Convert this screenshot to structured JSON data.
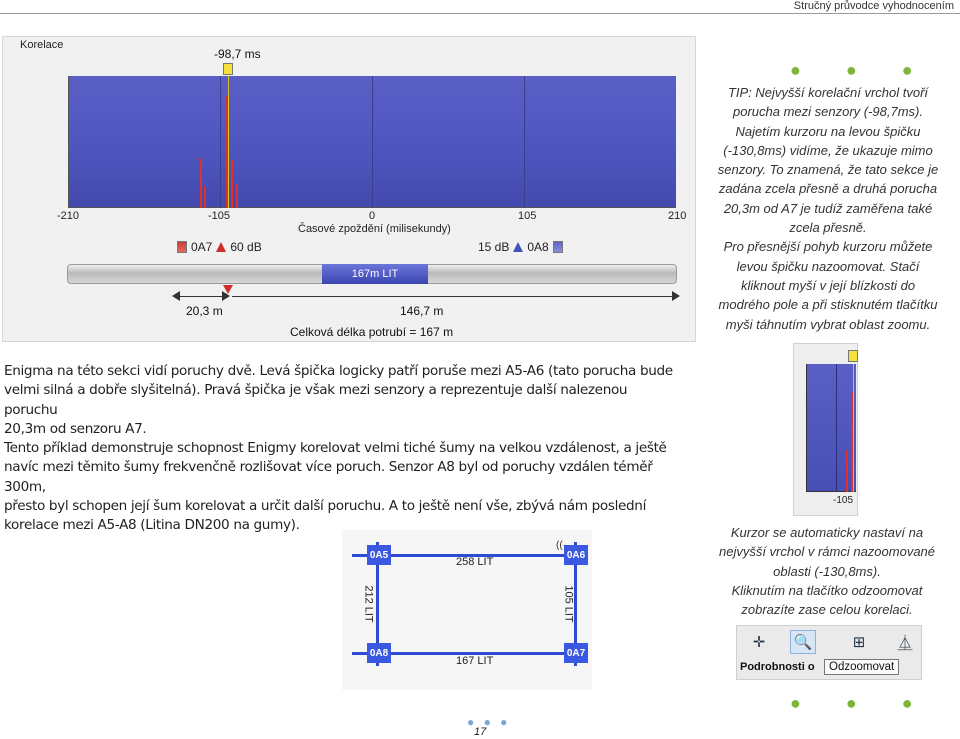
{
  "header": {
    "title": "Stručný průvodce vyhodnocením"
  },
  "correlation": {
    "panel_title": "Korelace",
    "cursor_label": "-98,7 ms",
    "ticks": [
      "-210",
      "-105",
      "0",
      "105",
      "210"
    ],
    "axis_label": "Časové zpoždění (milisekundy)",
    "left_sensor": {
      "name": "0A7",
      "level": "60 dB"
    },
    "right_sensor": {
      "name": "0A8",
      "level": "15 dB"
    },
    "pipe_label": "167m LIT",
    "dist_left": "20,3 m",
    "dist_right": "146,7 m",
    "total_length": "Celková délka potrubí = 167 m",
    "colors": {
      "plot": "#5057c0",
      "spike": "#e0302a",
      "cursor": "#f4e23c"
    }
  },
  "tip": {
    "lines": [
      "TIP: Nejvyšší korelační vrchol tvoří",
      "porucha mezi senzory (-98,7ms).",
      "Najetím kurzoru na levou špičku",
      "(-130,8ms) vidíme, že ukazuje mimo",
      "senzory. To znamená, že tato sekce je",
      "zadána zcela přesně a druhá porucha",
      "20,3m od A7 je tudíž zaměřena také",
      "zcela přesně.",
      "Pro přesnější pohyb kurzoru můžete",
      "levou špičku nazoomovat. Stačí",
      "kliknout myší v její blízkosti do",
      "modrého pole a při stisknutém tlačítku",
      "myši táhnutím vybrat oblast zoomu."
    ]
  },
  "body": {
    "para1": [
      "Enigma na této sekci vidí poruchy dvě. Levá špička logicky patří poruše mezi A5-A6 (tato porucha bude",
      "velmi silná a dobře slyšitelná). Pravá špička je však mezi senzory a reprezentuje další nalezenou poruchu",
      "20,3m od senzoru A7."
    ],
    "para2": [
      "Tento příklad demonstruje schopnost Enigmy korelovat velmi tiché šumy na velkou vzdálenost, a ještě",
      "navíc mezi těmito šumy frekvenčně rozlišovat více poruch. Senzor A8 byl od poruchy vzdálen téměř 300m,",
      "přesto byl schopen její šum korelovat a určit další poruchu. A to ještě není vše, zbývá nám poslední",
      "korelace mezi A5-A8 (Litina DN200 na gumy)."
    ]
  },
  "zoom": {
    "tick": "-105"
  },
  "caption": {
    "lines": [
      "Kurzor se automaticky nastaví na",
      "nejvyšší vrchol v rámci nazoomované",
      "oblasti (-130,8ms).",
      "Kliknutím na tlačítko odzoomovat",
      "zobrazíte zase celou korelaci."
    ]
  },
  "toolbar": {
    "details_label": "Podrobnosti o",
    "tooltip": "Odzoomovat",
    "icons": [
      "cursor-cross-icon",
      "zoom-icon",
      "network-icon",
      "spectrum-icon"
    ]
  },
  "network": {
    "nodes": [
      "0A5",
      "0A6",
      "0A8",
      "0A7"
    ],
    "edge_top": "258 LIT",
    "edge_bottom": "167 LIT",
    "edge_left": "212 LIT",
    "edge_right": "105 LIT"
  },
  "page": {
    "dots": "● ● ●",
    "number": "17"
  },
  "decor": {
    "dots": "● ● ●"
  }
}
